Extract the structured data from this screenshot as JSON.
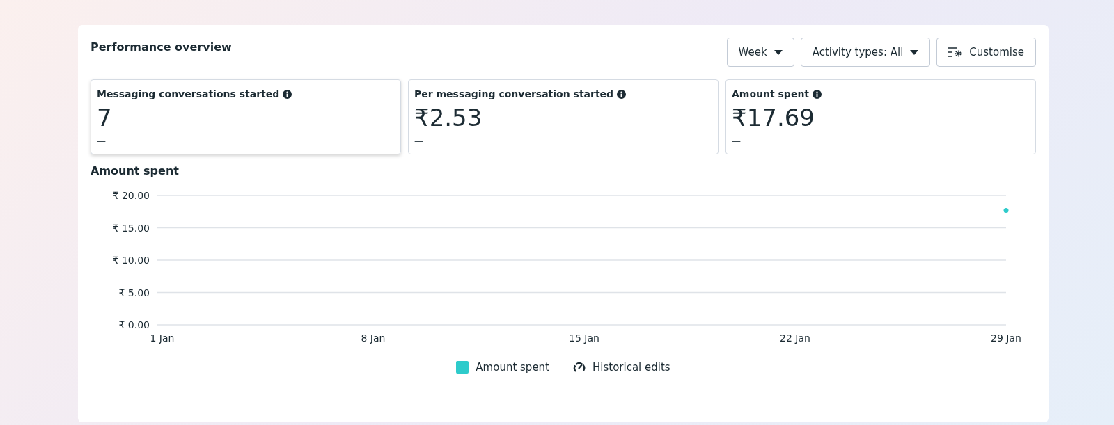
{
  "title": "Performance overview",
  "controls": [
    {
      "kind": "dropdown",
      "label": "Week"
    },
    {
      "kind": "dropdown",
      "label": "Activity types: All"
    },
    {
      "kind": "customise",
      "label": "Customise"
    }
  ],
  "metrics": [
    {
      "label": "Messaging conversations started",
      "value": "7",
      "change": "—",
      "selected": true
    },
    {
      "label": "Per messaging conversation started",
      "value": "₹2.53",
      "change": "—",
      "selected": false
    },
    {
      "label": "Amount spent",
      "value": "₹17.69",
      "change": "—",
      "selected": false
    }
  ],
  "chart": {
    "title": "Amount spent",
    "chart_data": {
      "type": "line",
      "categories": [
        "1 Jan",
        "8 Jan",
        "15 Jan",
        "22 Jan",
        "29 Jan"
      ],
      "series": [
        {
          "name": "Amount spent",
          "color": "#2ecbcb",
          "marker": true,
          "values": [
            null,
            null,
            null,
            null,
            17.7
          ]
        }
      ],
      "grid": true,
      "ylim": [
        0,
        20
      ],
      "yticks": [
        {
          "value": 0,
          "label": "₹ 0.00"
        },
        {
          "value": 5,
          "label": "₹ 5.00"
        },
        {
          "value": 10,
          "label": "₹ 10.00"
        },
        {
          "value": 15,
          "label": "₹ 15.00"
        },
        {
          "value": 20,
          "label": "₹ 20.00"
        }
      ]
    },
    "legend": [
      {
        "kind": "edits",
        "label": "Historical edits"
      }
    ]
  }
}
